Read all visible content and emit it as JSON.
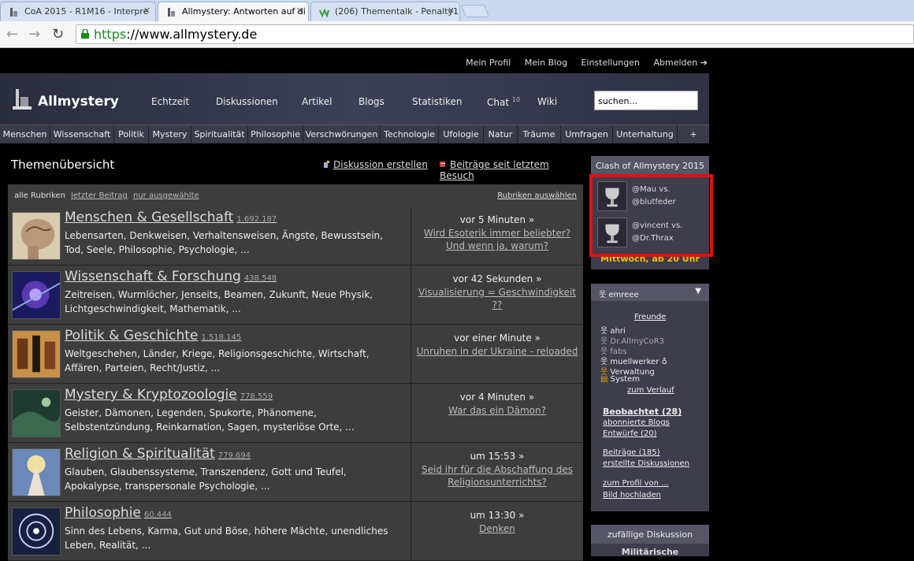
{
  "browser": {
    "tabs": [
      {
        "label": "CoA 2015 - R1M16 - Interpre"
      },
      {
        "label": "Allmystery: Antworten auf di"
      },
      {
        "label": "(206) Thementalk - Penalty1"
      }
    ],
    "url_https": "https",
    "url_rest": "://www.allmystery.de"
  },
  "toplinks": [
    "Mein Profil",
    "Mein Blog",
    "Einstellungen",
    "Abmelden ➔"
  ],
  "site": {
    "logo": "Allmystery",
    "nav": [
      "Echtzeit",
      "Diskussionen",
      "Artikel",
      "Blogs",
      "Statistiken",
      "Chat",
      "Wiki"
    ],
    "chat_count": "10",
    "search_placeholder": "suchen..."
  },
  "categories": [
    "Menschen",
    "Wissenschaft",
    "Politik",
    "Mystery",
    "Spiritualität",
    "Philosophie",
    "Verschwörungen",
    "Technologie",
    "Ufologie",
    "Natur",
    "Träume",
    "Umfragen",
    "Unterhaltung",
    "+"
  ],
  "main": {
    "title": "Themenübersicht",
    "create_label": "Diskussion erstellen",
    "since_label": "Beiträge seit letztem Besuch",
    "filter": {
      "all": "alle Rubriken",
      "last": "letzter Beitrag",
      "selected": "nur ausgewählte",
      "choose": "Rubriken auswählen"
    },
    "rows": [
      {
        "title": "Menschen & Gesellschaft",
        "count": "1.692.187",
        "desc": "Lebensarten, Denkweisen, Verhaltensweisen, Ängste, Bewusstsein, Tod, Seele, Philosophie, Psychologie, ...",
        "time": "vor 5 Minuten »",
        "thread": "Wird Esoterik immer beliebter? Und wenn ja, warum?"
      },
      {
        "title": "Wissenschaft & Forschung",
        "count": "438.548",
        "desc": "Zeitreisen, Wurmlöcher, Jenseits, Beamen, Zukunft, Neue Physik, Lichtgeschwindigkeit, Mathematik, ...",
        "time": "vor 42 Sekunden »",
        "thread": "Visualisierung = Geschwindigkeit ??"
      },
      {
        "title": "Politik & Geschichte",
        "count": "1.518.145",
        "desc": "Weltgeschehen, Länder, Kriege, Religionsgeschichte, Wirtschaft, Affären, Parteien, Recht/Justiz, ...",
        "time": "vor einer Minute »",
        "thread": "Unruhen in der Ukraine - reloaded"
      },
      {
        "title": "Mystery & Kryptozoologie",
        "count": "778.559",
        "desc": "Geister, Dämonen, Legenden, Spukorte, Phänomene, Selbstentzündung, Reinkarnation, Sagen, mysteriöse Orte, ...",
        "time": "vor 4 Minuten »",
        "thread": "War das ein Dämon?"
      },
      {
        "title": "Religion & Spiritualität",
        "count": "779.694",
        "desc": "Glauben, Glaubenssysteme, Transzendenz, Gott und Teufel, Apokalypse, transpersonale Psychologie, ...",
        "time": "um 15:53 »",
        "thread": "Seid ihr für die Abschaffung des Religionsunterrichts?"
      },
      {
        "title": "Philosophie",
        "count": "60.444",
        "desc": "Sinn des Lebens, Karma, Gut und Böse, höhere Mächte, unendliches Leben, Realität, ...",
        "time": "um 13:30 »",
        "thread": "Denken"
      }
    ]
  },
  "sidebar": {
    "coa_title": "Clash of Allmystery 2015",
    "matches": [
      {
        "line1": "@Mau vs.",
        "line2": "@blutfeder"
      },
      {
        "line1": "@vincent vs.",
        "line2": "@Dr.Thrax"
      }
    ],
    "coa_when": "Mittwoch, ab 20 Uhr",
    "user": "emreee",
    "friends_label": "Freunde",
    "friends": [
      {
        "name": "ahri",
        "dim": false
      },
      {
        "name": "Dr.AllmyCoR3",
        "dim": true
      },
      {
        "name": "fabs",
        "dim": true
      },
      {
        "name": "muellwerker",
        "dim": false
      },
      {
        "name": "Verwaltung",
        "dim": false
      },
      {
        "name": "System",
        "dim": false
      }
    ],
    "history": "zum Verlauf",
    "watched": "Beobachtet (28)",
    "blogs": "abonnierte Blogs",
    "drafts": "Entwürfe (20)",
    "posts": "Beiträge (185)",
    "created": "erstellte Diskussionen",
    "profile": "zum Profil von ...",
    "upload": "Bild hochladen",
    "random_title": "zufällige Diskussion",
    "random_item": "Militärische"
  }
}
